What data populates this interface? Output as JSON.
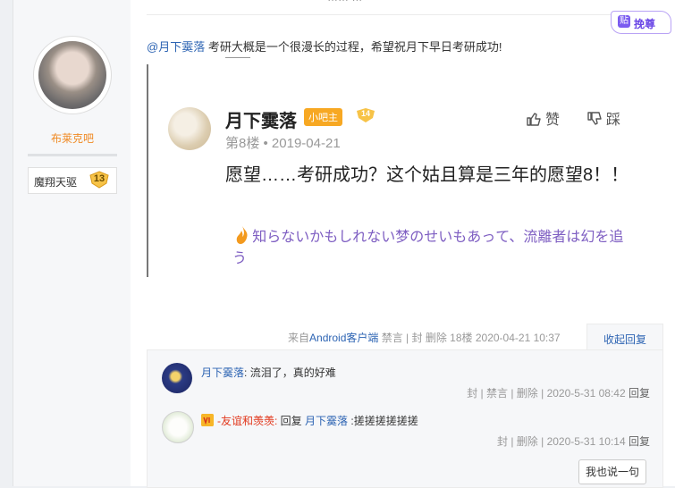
{
  "user": {
    "name": "布莱克吧",
    "forum_name": "魔翔天驱",
    "level": "13"
  },
  "top_fragment": "…… …",
  "badge": {
    "icon": "贴",
    "label": "挽尊"
  },
  "reply": {
    "at_user": "@月下霙落",
    "text": " 考研大概是一个很漫长的过程，希望祝月下早日考研成功!"
  },
  "quote": {
    "user": "月下霙落",
    "role_tag": "小吧主",
    "level": "14",
    "meta": "第8楼 • 2019-04-21",
    "like_label": "赞",
    "dislike_label": "踩",
    "body": "愿望……考研成功？这个姑且算是三年的愿望8！！",
    "signature": "知らないかもしれない梦のせいもあって、流離者は幻を追う"
  },
  "post_footer": {
    "from_prefix": "来自",
    "client": "Android客户端",
    "actions": " 禁言 |  封  删除  18楼  2020-04-21 10:37",
    "collapse_label": "收起回复"
  },
  "comments": [
    {
      "user": "月下霙落",
      "sep": ": ",
      "text": "流泪了，真的好难",
      "footer_actions": "封 | 禁言 | 删除 | 2020-5-31 08:42 ",
      "reply_label": "回复"
    },
    {
      "user": "-友谊和羡羡:",
      "text_prefix": " 回复 ",
      "reply_to": "月下霙落",
      "text": " :搓搓搓搓搓搓",
      "footer_actions": "封 | 删除 | 2020-5-31 10:14 ",
      "reply_label": "回复"
    }
  ],
  "say_button": "我也说一句",
  "colors": {
    "link": "#2d64b3",
    "username_orange": "#f08a24",
    "role_tag": "#f7a823",
    "signature": "#7e5ec2",
    "badge": "#6b47e6"
  }
}
